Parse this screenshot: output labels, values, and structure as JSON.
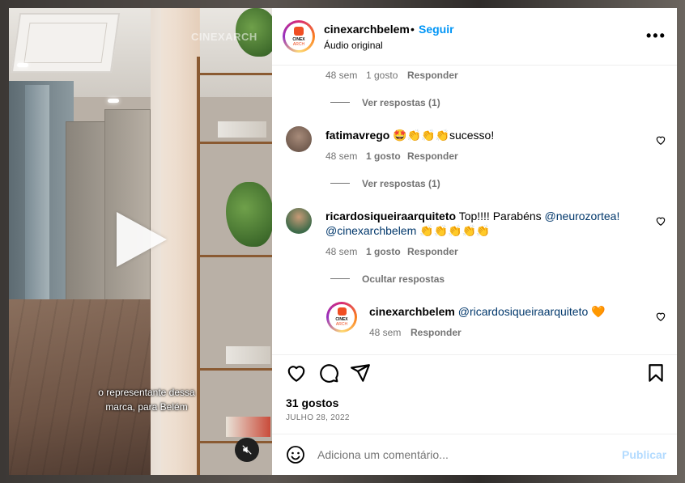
{
  "post": {
    "username": "cinexarchbelem",
    "separator": "•",
    "follow_label": "Seguir",
    "audio_label": "Áudio original",
    "more_label": "•••"
  },
  "video": {
    "watermark": "CINEXARCH",
    "caption_line1": "o representante dessa",
    "caption_line2": "marca, para Belém"
  },
  "comments": [
    {
      "meta_time": "48 sem",
      "meta_likes": "1 gosto",
      "meta_reply": "Responder",
      "view_replies": "Ver respostas (1)"
    },
    {
      "username": "fatimavrego",
      "text": "🤩👏👏👏sucesso!",
      "meta_time": "48 sem",
      "meta_likes": "1 gosto",
      "meta_reply": "Responder",
      "view_replies": "Ver respostas (1)"
    },
    {
      "username": "ricardosiqueiraarquiteto",
      "text_pre": "Top!!!! Parabéns ",
      "mention1": "@neurozortea!",
      "mention2": "@cinexarchbelem",
      "text_post": " 👏👏👏👏👏",
      "meta_time": "48 sem",
      "meta_likes": "1 gosto",
      "meta_reply": "Responder",
      "hide_replies": "Ocultar respostas"
    },
    {
      "username": "cinexarchbelem",
      "mention": "@ricardosiqueiraarquiteto",
      "text_post": " 🧡",
      "meta_time": "48 sem",
      "meta_reply": "Responder"
    }
  ],
  "logo": {
    "line1": "CINEX",
    "line2": "ARCH"
  },
  "likes_label": "31 gostos",
  "date_label": "JULHO 28, 2022",
  "add_comment": {
    "placeholder": "Adiciona um comentário...",
    "publish_label": "Publicar"
  },
  "colors": {
    "accent": "#0095f6",
    "publish_disabled": "#b3dbff",
    "mention": "#00376b",
    "secondary_text": "#737373"
  }
}
